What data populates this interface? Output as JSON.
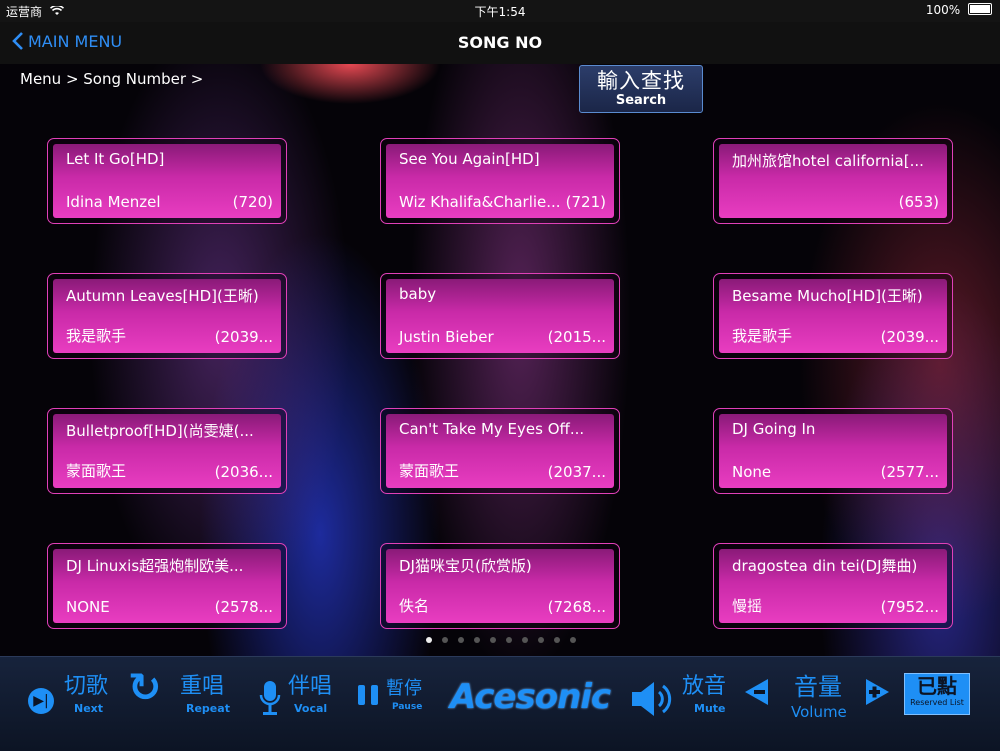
{
  "status": {
    "carrier": "运营商",
    "time": "下午1:54",
    "battery": "100%"
  },
  "nav": {
    "back_label": "MAIN MENU",
    "title": "SONG NO"
  },
  "breadcrumb": "Menu > Song Number >",
  "search": {
    "label_cn": "輸入查找",
    "label_en": "Search"
  },
  "songs": [
    {
      "title": "Let It Go[HD]",
      "artist": "Idina Menzel",
      "num": "(720)"
    },
    {
      "title": "See You Again[HD]",
      "artist": "Wiz Khalifa&Charlie...",
      "num": "(721)"
    },
    {
      "title": "加州旅馆hotel california[...",
      "artist": "",
      "num": "(653)"
    },
    {
      "title": "Autumn Leaves[HD](王晰)",
      "artist": "我是歌手",
      "num": "(2039..."
    },
    {
      "title": "baby",
      "artist": "Justin Bieber",
      "num": "(2015..."
    },
    {
      "title": "Besame Mucho[HD](王晰)",
      "artist": "我是歌手",
      "num": "(2039..."
    },
    {
      "title": "Bulletproof[HD](尚雯婕(...",
      "artist": "蒙面歌王",
      "num": "(2036..."
    },
    {
      "title": "Can't Take My Eyes Off...",
      "artist": "蒙面歌王",
      "num": "(2037..."
    },
    {
      "title": "DJ Going In",
      "artist": "None",
      "num": "(2577..."
    },
    {
      "title": "DJ Linuxis超强炮制欧美...",
      "artist": "NONE",
      "num": "(2578..."
    },
    {
      "title": "DJ猫咪宝贝(欣赏版)",
      "artist": "佚名",
      "num": "(7268..."
    },
    {
      "title": "dragostea din tei(DJ舞曲)",
      "artist": "慢摇",
      "num": "(7952..."
    }
  ],
  "pager": {
    "count": 10,
    "current": 1
  },
  "toolbar": {
    "next": {
      "cn": "切歌",
      "en": "Next"
    },
    "repeat": {
      "cn": "重唱",
      "en": "Repeat"
    },
    "vocal": {
      "cn": "伴唱",
      "en": "Vocal"
    },
    "pause": {
      "cn": "暫停",
      "en": "Pause"
    },
    "logo": "Acesonic",
    "mute": {
      "cn": "放音",
      "en": "Mute"
    },
    "volume": {
      "cn": "音量",
      "en": "Volume"
    },
    "reserved": {
      "cn": "已點",
      "en": "Reserved List"
    }
  },
  "colors": {
    "accent": "#1e8ff5",
    "card": "#d22fb0",
    "card_border": "#e040b8"
  },
  "icons": [
    "wifi-icon",
    "battery-icon",
    "chevron-left-icon",
    "play-next-icon",
    "repeat-icon",
    "microphone-icon",
    "pause-icon",
    "speaker-icon",
    "minus-icon",
    "plus-icon"
  ]
}
